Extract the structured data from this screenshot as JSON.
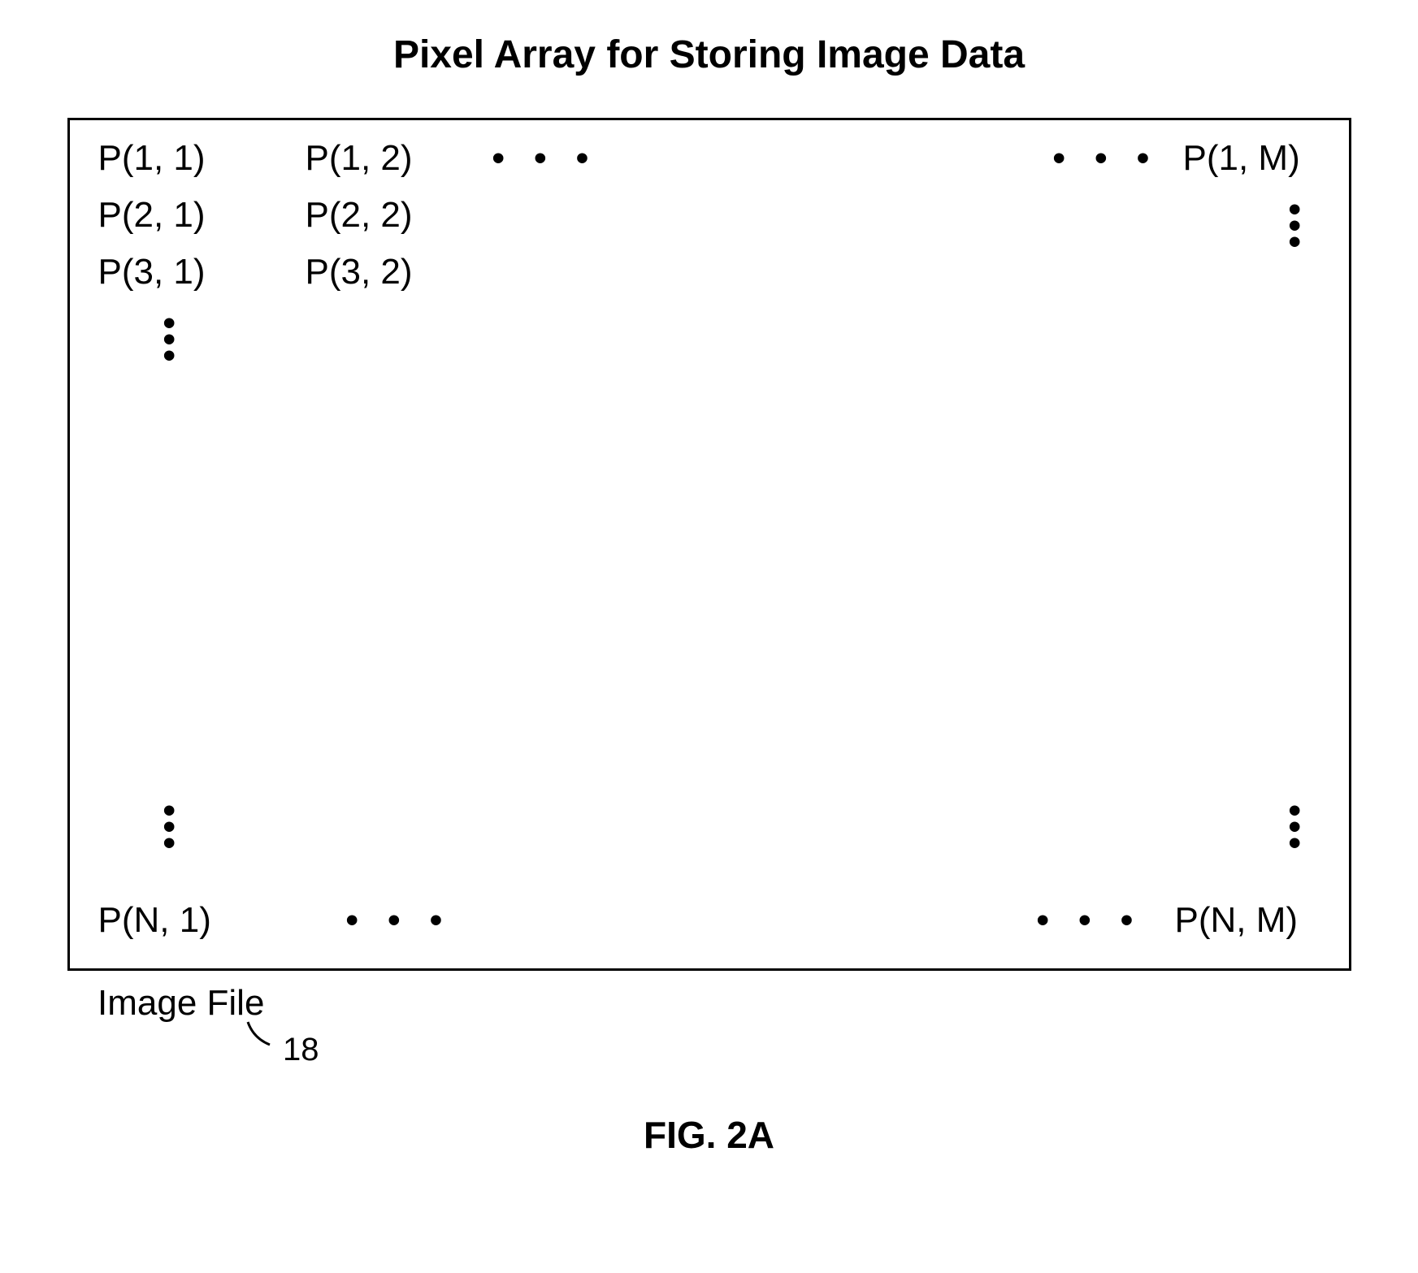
{
  "title": "Pixel Array for Storing Image Data",
  "cells": {
    "p11": "P(1, 1)",
    "p12": "P(1, 2)",
    "p1m": "P(1, M)",
    "p21": "P(2, 1)",
    "p22": "P(2, 2)",
    "p31": "P(3, 1)",
    "p32": "P(3, 2)",
    "pn1": "P(N, 1)",
    "pnm": "P(N, M)"
  },
  "hdots_top_left": "• • •",
  "hdots_top_right": "• • •",
  "hdots_bottom_left": "• • •",
  "hdots_bottom_right": "• • •",
  "label_below": "Image File",
  "ref_num": "18",
  "figure_label": "FIG. 2A"
}
